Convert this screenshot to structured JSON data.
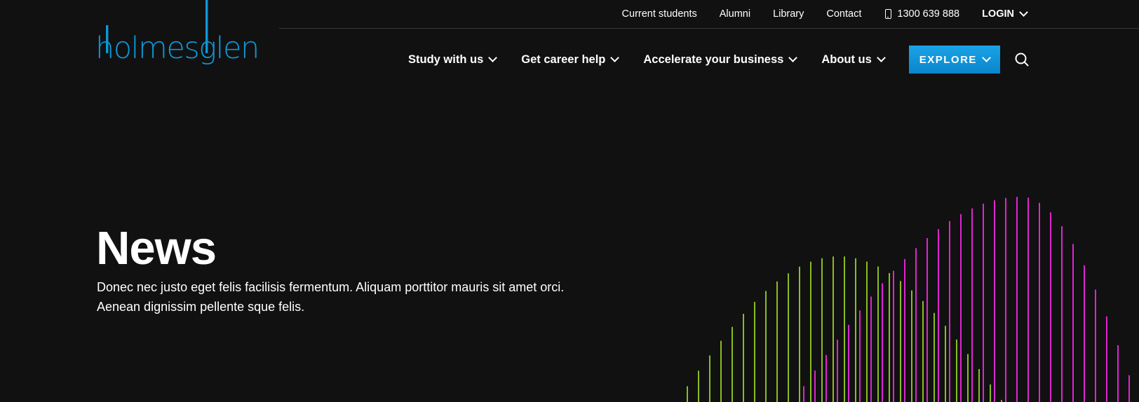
{
  "brand": {
    "logo_text": "holmesglen",
    "logo_color": "#0e97d6"
  },
  "utility_nav": {
    "links": [
      "Current students",
      "Alumni",
      "Library",
      "Contact"
    ],
    "phone": "1300 639 888",
    "login_label": "LOGIN"
  },
  "main_nav": {
    "items": [
      "Study with us",
      "Get career help",
      "Accelerate your business",
      "About us"
    ],
    "explore_label": "EXPLORE",
    "accent_color": "#1199dd"
  },
  "hero": {
    "title": "News",
    "description_line1": "Donec nec justo eget felis facilisis fermentum. Aliquam porttitor mauris sit amet orci.",
    "description_line2": "Aenean dignissim pellente sque felis."
  },
  "decoration": {
    "green_color": "#8bbd1f",
    "magenta_color": "#e024d2"
  }
}
